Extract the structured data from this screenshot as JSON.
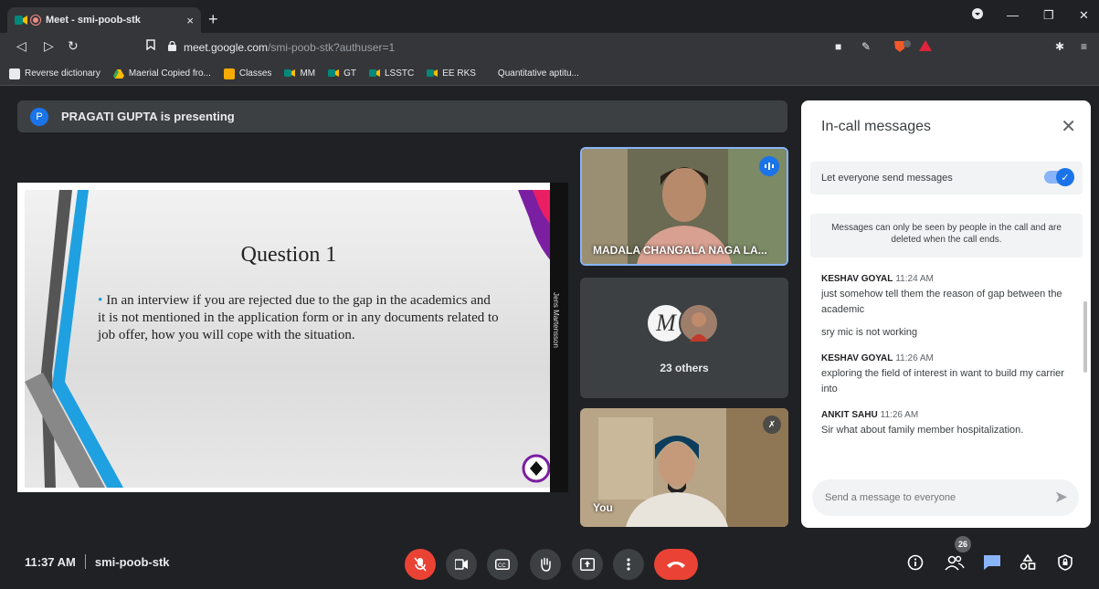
{
  "browser": {
    "tab_title": "Meet - smi-poob-stk",
    "tab_close": "×",
    "new_tab": "+",
    "url_host": "meet.google.com",
    "url_path": "/smi-poob-stk?authuser=1"
  },
  "bookmarks": [
    {
      "label": "Reverse dictionary",
      "icon": "reverse-dictionary-icon",
      "color": "#e8eaed"
    },
    {
      "label": "Maerial Copied fro...",
      "icon": "google-drive-icon",
      "color": "#fbbc04"
    },
    {
      "label": "Classes",
      "icon": "classroom-icon",
      "color": "#f9ab00"
    },
    {
      "label": "MM",
      "icon": "meet-icon",
      "color": "#00897b"
    },
    {
      "label": "GT",
      "icon": "meet-icon",
      "color": "#00897b"
    },
    {
      "label": "LSSTC",
      "icon": "meet-icon",
      "color": "#00897b"
    },
    {
      "label": "EE RKS",
      "icon": "meet-icon",
      "color": "#00897b"
    },
    {
      "label": "Quantitative aptitu...",
      "icon": "",
      "color": ""
    }
  ],
  "meet": {
    "presenter_initial": "P",
    "presenting_text": "PRAGATI GUPTA is presenting",
    "slide": {
      "title": "Question 1",
      "body": "In an interview if you are rejected due to the gap in the academics and it is not mentioned in the application form or in any documents related to job offer, how you will cope with the situation.",
      "side_name": "Jens Martensson"
    },
    "tiles": {
      "speaker_name": "MADALA CHANGALA NAGA LA...",
      "others_label": "23 others",
      "self_label": "You"
    }
  },
  "chat": {
    "title": "In-call messages",
    "toggle_label": "Let everyone send messages",
    "toggle_on": true,
    "notice": "Messages can only be seen by people in the call and are deleted when the call ends.",
    "messages": [
      {
        "sender": "KESHAV GOYAL",
        "time": "11:24 AM",
        "text": "just somehow tell them the reason of gap between the academic",
        "extra": "sry mic is not working"
      },
      {
        "sender": "KESHAV GOYAL",
        "time": "11:26 AM",
        "text": "exploring the field of interest in want to build my carrier into",
        "extra": ""
      },
      {
        "sender": "ANKIT SAHU",
        "time": "11:26 AM",
        "text": "Sir what about family member hospitalization.",
        "extra": ""
      }
    ],
    "input_placeholder": "Send a message to everyone"
  },
  "bottom": {
    "time": "11:37 AM",
    "meeting_code": "smi-poob-stk",
    "participants_count": "26"
  },
  "colors": {
    "accent": "#1a73e8",
    "danger": "#ea4335",
    "surface": "#3c4043",
    "background": "#202124"
  }
}
